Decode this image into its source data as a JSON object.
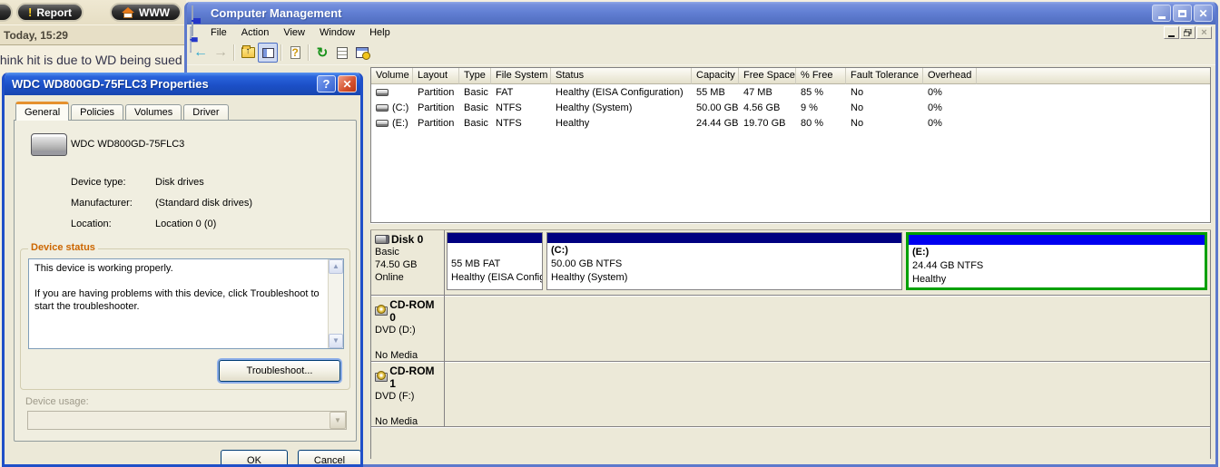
{
  "background": {
    "up_button": "↑",
    "report_button": "Report",
    "www_button": "WWW",
    "date_line": "Today, 15:29",
    "message": "think hit is due to WD being sued"
  },
  "cm": {
    "title": "Computer Management",
    "menus": [
      "File",
      "Action",
      "View",
      "Window",
      "Help"
    ],
    "volume_list": {
      "headers": [
        "Volume",
        "Layout",
        "Type",
        "File System",
        "Status",
        "Capacity",
        "Free Space",
        "% Free",
        "Fault Tolerance",
        "Overhead"
      ],
      "rows": [
        {
          "volume": "",
          "layout": "Partition",
          "type": "Basic",
          "fs": "FAT",
          "status": "Healthy (EISA Configuration)",
          "capacity": "55 MB",
          "free": "47 MB",
          "pct": "85 %",
          "fault": "No",
          "overhead": "0%"
        },
        {
          "volume": "(C:)",
          "layout": "Partition",
          "type": "Basic",
          "fs": "NTFS",
          "status": "Healthy (System)",
          "capacity": "50.00 GB",
          "free": "4.56 GB",
          "pct": "9 %",
          "fault": "No",
          "overhead": "0%"
        },
        {
          "volume": "(E:)",
          "layout": "Partition",
          "type": "Basic",
          "fs": "NTFS",
          "status": "Healthy",
          "capacity": "24.44 GB",
          "free": "19.70 GB",
          "pct": "80 %",
          "fault": "No",
          "overhead": "0%"
        }
      ]
    },
    "disk0": {
      "name": "Disk 0",
      "type": "Basic",
      "size": "74.50 GB",
      "status": "Online",
      "partitions": [
        {
          "label": "",
          "line2": "55 MB FAT",
          "line3": "Healthy (EISA Configura"
        },
        {
          "label": "(C:)",
          "line2": "50.00 GB NTFS",
          "line3": "Healthy (System)"
        },
        {
          "label": "(E:)",
          "line2": "24.44 GB NTFS",
          "line3": "Healthy"
        }
      ]
    },
    "cdrom0": {
      "name": "CD-ROM 0",
      "line2": "DVD (D:)",
      "line3": "No Media"
    },
    "cdrom1": {
      "name": "CD-ROM 1",
      "line2": "DVD (F:)",
      "line3": "No Media"
    }
  },
  "dialog": {
    "title": "WDC WD800GD-75FLC3 Properties",
    "help_button": "?",
    "close_button": "✕",
    "tabs": [
      "General",
      "Policies",
      "Volumes",
      "Driver"
    ],
    "device_name": "WDC WD800GD-75FLC3",
    "fields": [
      {
        "label": "Device type:",
        "value": "Disk drives"
      },
      {
        "label": "Manufacturer:",
        "value": "(Standard disk drives)"
      },
      {
        "label": "Location:",
        "value": "Location 0 (0)"
      }
    ],
    "group_label": "Device status",
    "status_line1": "This device is working properly.",
    "status_line2": "If you are having problems with this device, click Troubleshoot to start the troubleshooter.",
    "troubleshoot_button": "Troubleshoot...",
    "device_usage_label": "Device usage:",
    "ok_button": "OK",
    "cancel_button": "Cancel"
  },
  "colors": {
    "partition_primary": "#000080",
    "partition_selected_strip": "#0000f0",
    "selection_border_green": "#00a000",
    "groupbox_label": "#cc6600",
    "titlebar_active": "#1c50c8",
    "titlebar_inactive": "#6280d4",
    "window_bg": "#ece9d8"
  }
}
